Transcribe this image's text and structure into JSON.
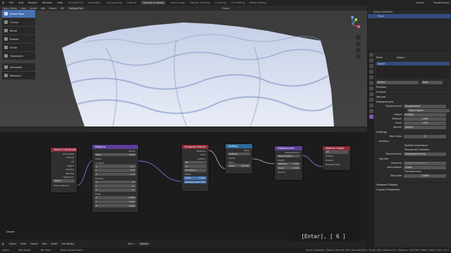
{
  "topbar": {
    "menus": [
      "File",
      "Edit",
      "Render",
      "Window",
      "Help"
    ],
    "workspaces": [
      "3D View Full",
      "Animation",
      "Compositing",
      "Default",
      "Geometry Nodes",
      "Game Logic",
      "Motion Tracking",
      "Scripting",
      "UV Editing",
      "Video Editing"
    ],
    "active_workspace": "Geometry Nodes",
    "scene": "Scene",
    "view_layer": "RenderLayer"
  },
  "viewport": {
    "header": [
      "Object Mode",
      "View",
      "Select",
      "Add",
      "Object",
      "GIS",
      "RetopoFlow",
      "Global"
    ],
    "tools": [
      "Select Box",
      "Cursor",
      "Move",
      "Rotate",
      "Scale",
      "Transform",
      "Annotate",
      "Measure"
    ],
    "active_tool": "Select Box",
    "axes": [
      "X",
      "Y",
      "Z"
    ]
  },
  "node_editor": {
    "header": [
      "Object",
      "View",
      "Select",
      "Add",
      "Node",
      "Use Nodes",
      "Slot 1",
      "Desert"
    ],
    "frame_label": "Desert",
    "nodes": {
      "texcoord": {
        "title": "Texture Coordinate",
        "outputs": [
          "Generated",
          "Normal",
          "UV",
          "Object",
          "Camera",
          "Window",
          "Reflection"
        ],
        "object_label": "Object",
        "from_instancer": "From Instancer"
      },
      "mapping": {
        "title": "Mapping",
        "vector_out": "Vector",
        "type_label": "Type:",
        "type_val": "Point",
        "vector_in": "Vector",
        "location": "Location",
        "rotation": "Rotation",
        "scale": "Scale",
        "axes": [
          "X",
          "Y",
          "Z"
        ],
        "loc_vals": [
          "0 m",
          "0 m",
          "0 m"
        ],
        "rot_vals": [
          "0°",
          "0°",
          "0°"
        ],
        "scale_vals": [
          "1.000",
          "1.000",
          "1.000"
        ]
      },
      "musgrave": {
        "title": "Musgrave Texture",
        "outputs": [
          "Distance",
          "Color",
          "Position"
        ],
        "dim": "3D",
        "feature": "F1",
        "metric": "Euclidean",
        "vector": "Vector",
        "scale_label": "Scale",
        "scale_val": "3.000",
        "random_label": "Randomness",
        "random_val": "1.000"
      },
      "multiply": {
        "title": "Multiply",
        "value_out": "Value",
        "op": "Multiply",
        "clamp": "Clamp",
        "value_in": "Value",
        "val": "-10.000"
      },
      "displacement": {
        "title": "Displacement",
        "out": "Displacement",
        "space": "Object Space",
        "height": "Height",
        "midlevel_label": "Midlevel",
        "midlevel_val": "1.000",
        "scale_label": "Scale",
        "scale_val": "1.000",
        "normal": "Normal"
      },
      "output": {
        "title": "Material Output",
        "target": "All",
        "surface": "Surface",
        "volume": "Volume",
        "displacement": "Displacement"
      }
    }
  },
  "outliner": {
    "title": "Scene Collection",
    "items": [
      "Plane"
    ]
  },
  "properties": {
    "object_tabs": [
      "Plane",
      "Desert"
    ],
    "slot": "Desert",
    "material": "Desert",
    "data_label": "Data",
    "sections": [
      "Preview",
      "Surface",
      "Volume",
      "Displacement"
    ],
    "displacement": {
      "label": "Displacement",
      "value": "Displacement"
    },
    "space_val": "Object Space",
    "height_label": "Height",
    "height_val": "Multiply",
    "midlevel_label": "Midlevel",
    "midlevel_val": "1.000",
    "scale_label": "Scale",
    "scale_val": "1.000",
    "normal_label": "Normal",
    "normal_val": "Default",
    "settings": "Settings",
    "pass_index_label": "Pass Index",
    "pass_index_val": "0",
    "surface_sub": "Surface",
    "multiple_importance": "Multiple Importance",
    "transparent_shadows": "Transparent Shadows",
    "displacement_method_label": "Displacement",
    "displacement_method_val": "Displacement Only",
    "volume_sub": "Volume",
    "sampling_label": "Sampling",
    "sampling_val": "Multiple Importance",
    "interp_label": "Interpolation",
    "interp_val": "Linear",
    "homogeneous": "Homogeneous",
    "step_label": "Step Rate",
    "step_val": "1.0000",
    "viewport_display": "Viewport Display",
    "custom_props": "Custom Properties"
  },
  "statusbar": {
    "select": "Select",
    "box_select": "Box Select",
    "pan": "Pan View",
    "context": "Node Context Menu",
    "stats": "Scene Collection | Plane | Verts:61,209 | Faces:60,604 | Tris:61,408 | Objects:1/1 | Memory: 2.60 GiB | VRAM: 2.8/8.0 GiB | 3.4.1"
  },
  "overlay": {
    "key_hint": "[Enter], [ 6 ]"
  },
  "colors": {
    "accent": "#4772b3",
    "tex_header": "#8b2b3a",
    "vec_header": "#5b3f99",
    "tex2_header": "#8b2b3a",
    "conv_header": "#2e6b99",
    "output_header": "#8b2b3a"
  }
}
